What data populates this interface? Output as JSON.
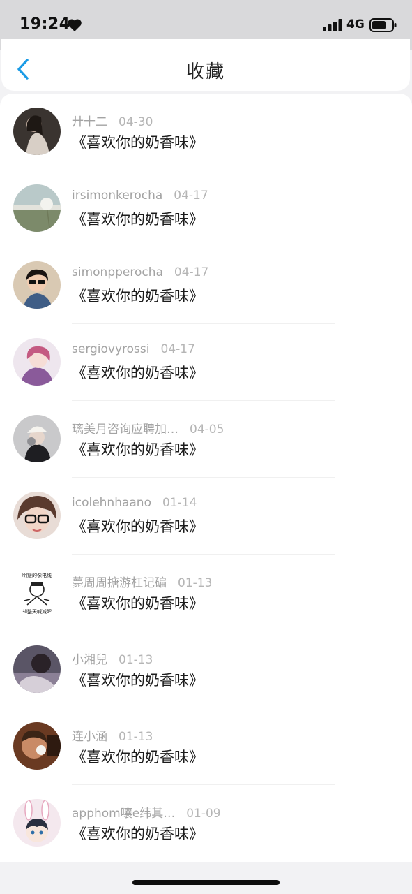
{
  "status_bar": {
    "time": "19:24",
    "network": "4G"
  },
  "header": {
    "title": "收藏"
  },
  "items": [
    {
      "user": "廾十二",
      "date": "04-30",
      "song": "《喜欢你的奶香味》",
      "avatar": "dark-photo"
    },
    {
      "user": "irsimonkerocha",
      "date": "04-17",
      "song": "《喜欢你的奶香味》",
      "avatar": "dandelion"
    },
    {
      "user": "simonpperocha",
      "date": "04-17",
      "song": "《喜欢你的奶香味》",
      "avatar": "sunglasses-person"
    },
    {
      "user": "sergiovyrossi",
      "date": "04-17",
      "song": "《喜欢你的奶香味》",
      "avatar": "pink-hair"
    },
    {
      "user": "璃美月咨询应聘加…",
      "date": "04-05",
      "song": "《喜欢你的奶香味》",
      "avatar": "hat-person"
    },
    {
      "user": "icolehnhaano",
      "date": "01-14",
      "song": "《喜欢你的奶香味》",
      "avatar": "glasses-person"
    },
    {
      "user": "薨周周搪游杠记碥",
      "date": "01-13",
      "song": "《喜欢你的奶香味》",
      "avatar": "cartoon-sketch",
      "avatar_text_top": "明瘦的像电线",
      "avatar_text_bottom": "却整天喊减肥"
    },
    {
      "user": "小湘兒",
      "date": "01-13",
      "song": "《喜欢你的奶香味》",
      "avatar": "dark-portrait"
    },
    {
      "user": "连小涵",
      "date": "01-13",
      "song": "《喜欢你的奶香味》",
      "avatar": "drinking-person"
    },
    {
      "user": "apphom嚷e纬其…",
      "date": "01-09",
      "song": "《喜欢你的奶香味》",
      "avatar": "bunny-cartoon"
    }
  ],
  "colors": {
    "accent": "#1a9be6",
    "meta_text": "#a3a3a3",
    "title_text": "#222222"
  }
}
